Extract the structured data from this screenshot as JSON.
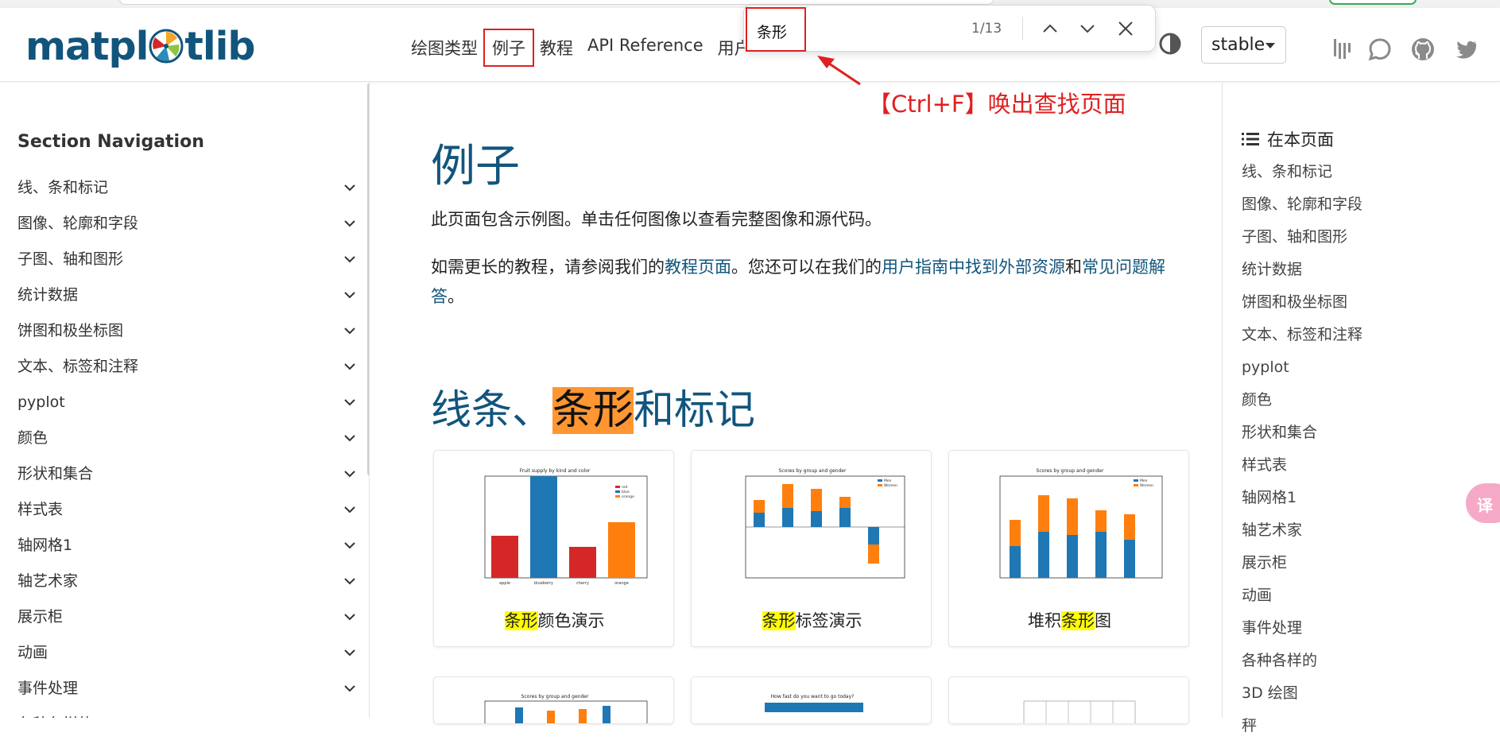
{
  "header": {
    "logo_text_pre": "matpl",
    "logo_text_post": "tlib",
    "nav": [
      {
        "label": "绘图类型",
        "active": false
      },
      {
        "label": "例子",
        "active": true
      },
      {
        "label": "教程",
        "active": false
      },
      {
        "label": "API Reference",
        "active": false
      },
      {
        "label": "用户",
        "active": false
      }
    ],
    "version_select": "stable"
  },
  "find_bar": {
    "query": "条形",
    "count": "1/13"
  },
  "annotation": "【Ctrl+F】唤出查找页面",
  "sidebar": {
    "title": "Section Navigation",
    "items": [
      "线、条和标记",
      "图像、轮廓和字段",
      "子图、轴和图形",
      "统计数据",
      "饼图和极坐标图",
      "文本、标签和注释",
      "pyplot",
      "颜色",
      "形状和集合",
      "样式表",
      "轴网格1",
      "轴艺术家",
      "展示柜",
      "动画",
      "事件处理",
      "各种各样的"
    ]
  },
  "main": {
    "title": "例子",
    "intro": "此页面包含示例图。单击任何图像以查看完整图像和源代码。",
    "para2_a": "如需更长的教程，请参阅我们的",
    "para2_link1": "教程页面",
    "para2_b": "。您还可以在我们的",
    "para2_link2": "用户指南中找到外部资源",
    "para2_c": "和",
    "para2_link3": "常见问题解答",
    "para2_d": "。",
    "section_title_a": "线条、",
    "section_title_hl": "条形",
    "section_title_b": "和标记",
    "cards": [
      {
        "hl": "条形",
        "rest": "颜色演示",
        "prefix": ""
      },
      {
        "hl": "条形",
        "rest": "标签演示",
        "prefix": ""
      },
      {
        "hl": "条形",
        "rest": "图",
        "prefix": "堆积"
      }
    ],
    "thumb_titles": [
      "Fruit supply by kind and color",
      "Scores by group and gender",
      "Scores by group and gender",
      "Scores by group and gender",
      "How fast do you want to go today?"
    ]
  },
  "toc": {
    "title": "在本页面",
    "items": [
      "线、条和标记",
      "图像、轮廓和字段",
      "子图、轴和图形",
      "统计数据",
      "饼图和极坐标图",
      "文本、标签和注释",
      "pyplot",
      "颜色",
      "形状和集合",
      "样式表",
      "轴网格1",
      "轴艺术家",
      "展示柜",
      "动画",
      "事件处理",
      "各种各样的",
      "3D 绘图",
      "秤"
    ]
  },
  "colors": {
    "brand": "#11557c",
    "highlight_current": "#ff9632",
    "highlight": "#ffff00",
    "annotation": "#e02020"
  }
}
